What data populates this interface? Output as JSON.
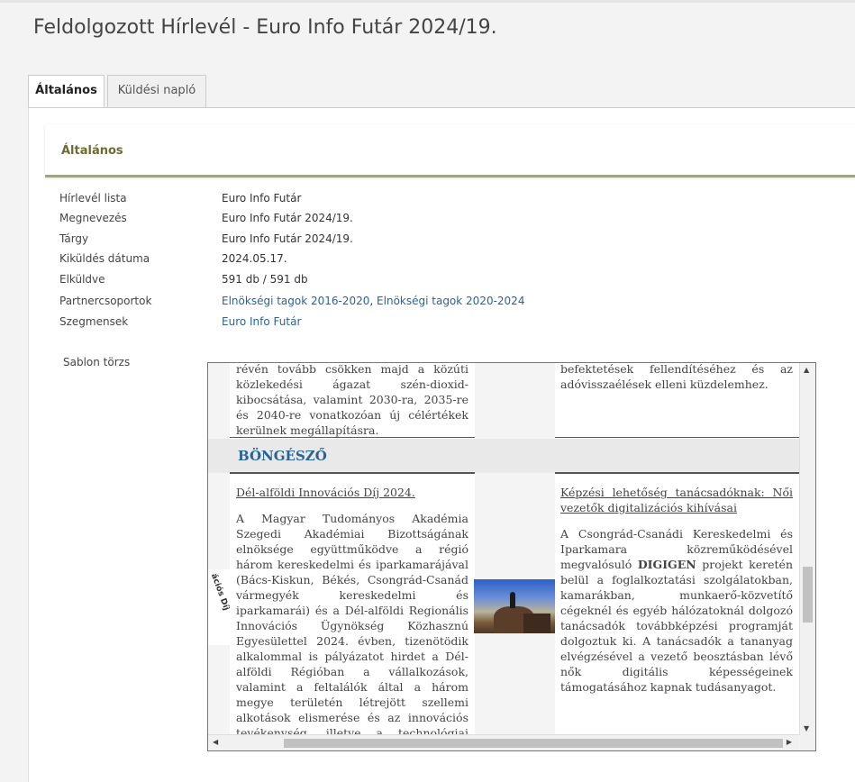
{
  "page": {
    "title": "Feldolgozott Hírlevél - Euro Info Futár 2024/19."
  },
  "tabs": [
    {
      "label": "Általános",
      "active": true
    },
    {
      "label": "Küldési napló",
      "active": false
    }
  ],
  "section": {
    "title": "Általános"
  },
  "properties": [
    {
      "label": "Hírlevél lista",
      "value": "Euro Info Futár"
    },
    {
      "label": "Megnevezés",
      "value": "Euro Info Futár 2024/19."
    },
    {
      "label": "Tárgy",
      "value": "Euro Info Futár 2024/19."
    },
    {
      "label": "Kiküldés dátuma",
      "value": "2024.05.17."
    },
    {
      "label": "Elküldve",
      "value": "591 db / 591 db"
    },
    {
      "label": "Partnercsoportok",
      "links": [
        "Elnökségi tagok 2016-2020",
        "Elnökségi tagok 2020-2024"
      ],
      "separator": ", "
    },
    {
      "label": "Szegmensek",
      "links": [
        "Euro Info Futár"
      ]
    }
  ],
  "template_body_label": "Sablon törzs",
  "newsletter": {
    "top_left_text": "révén tovább csökken majd a közúti közlekedési ágazat szén-dioxid-kibocsátása, valamint 2030-ra, 2035-re és 2040-re vonatkozóan új célértékek kerülnek megállapításra.",
    "top_right_text": "befektetések fellendítéséhez és az adóvisszaélések elleni küzdelemhez.",
    "section_title": "BÖNGÉSZŐ",
    "left_article": {
      "title": "Dél-alföldi Innovációs Díj 2024.",
      "body": "A Magyar Tudományos Akadémia Szegedi Akadémiai Bizottságának elnöksége együttműködve a régió három kereskedelmi és iparkamarájával (Bács-Kiskun, Békés, Csongrád-Csanád vármegyék kereskedelmi és iparkamarái) és a Dél-alföldi Regionális Innovációs Ügynökség Közhasznú Egyesülettel 2024. évben, tizenötödik alkalommal is pályázatot hirdet a Dél-alföldi Régióban a vállalkozások, valamint a feltalálók által a három megye területén létrejött szellemi alkotások elismerése és az innovációs tevékenység, illetve a technológiai transzfer támogatása érdekében."
    },
    "left_logo_text": "ációs Díj",
    "right_article": {
      "title": "Képzési lehetőség tanácsadóknak: Női vezetők digitalizációs kihívásai",
      "body_before": "A Csongrád-Csanádi Kereskedelmi és Iparkamara közreműködésével megvalósuló ",
      "body_strong": "DIGIGEN",
      "body_after": " projekt keretén belül a foglalkoztatási szolgálatokban, kamarákban, munkaerő-közvetítő cégeknél és egyéb hálózatoknál dolgozó tanácsadók továbbképzési programját dolgoztuk ki. A tanácsadók a tananyag elvégzésével a vezető beosztásban lévő nők digitális képességeinek támogatásához kapnak tudásanyagot."
    }
  },
  "icons": {
    "scroll_up": "▲",
    "scroll_down": "▼",
    "scroll_left": "◀",
    "scroll_right": "▶"
  }
}
